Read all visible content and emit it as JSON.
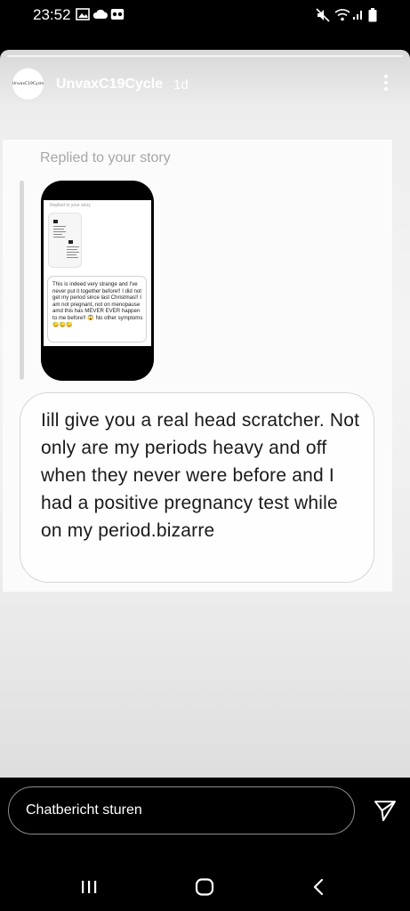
{
  "status_bar": {
    "time": "23:52",
    "left_icons": [
      "image-icon",
      "cloud-icon",
      "voicemail-icon"
    ],
    "right_icons": [
      "mute-icon",
      "wifi-icon",
      "signal-icon",
      "battery-icon"
    ]
  },
  "story": {
    "avatar_text": "UnvaxC19Cycle",
    "username": "UnvaxC19Cycle",
    "time_ago": "1d",
    "replied_label": "Replied to your story",
    "thumbnail": {
      "replied_label": "Replied to your story",
      "text": "This is indeed very strange and I've never put it together before!! I did not get my period since last Christmas!! I am not pregnant, not on menopause  amd this has MEVER EVER happen to me before!! 😱 No other symptoms 😓😓😓"
    },
    "message": "Iill give you a real head scratcher. Not only are my periods heavy and off when they never were before and I had a positive pregnancy test while on my period.bizarre"
  },
  "chat_input": {
    "placeholder": "Chatbericht sturen"
  },
  "nav": {
    "icons": [
      "recent-apps-icon",
      "home-icon",
      "back-icon"
    ]
  },
  "colors": {
    "background": "#000000",
    "story_background": "#f2f2f2",
    "secondary_text": "#a6a6a6"
  }
}
